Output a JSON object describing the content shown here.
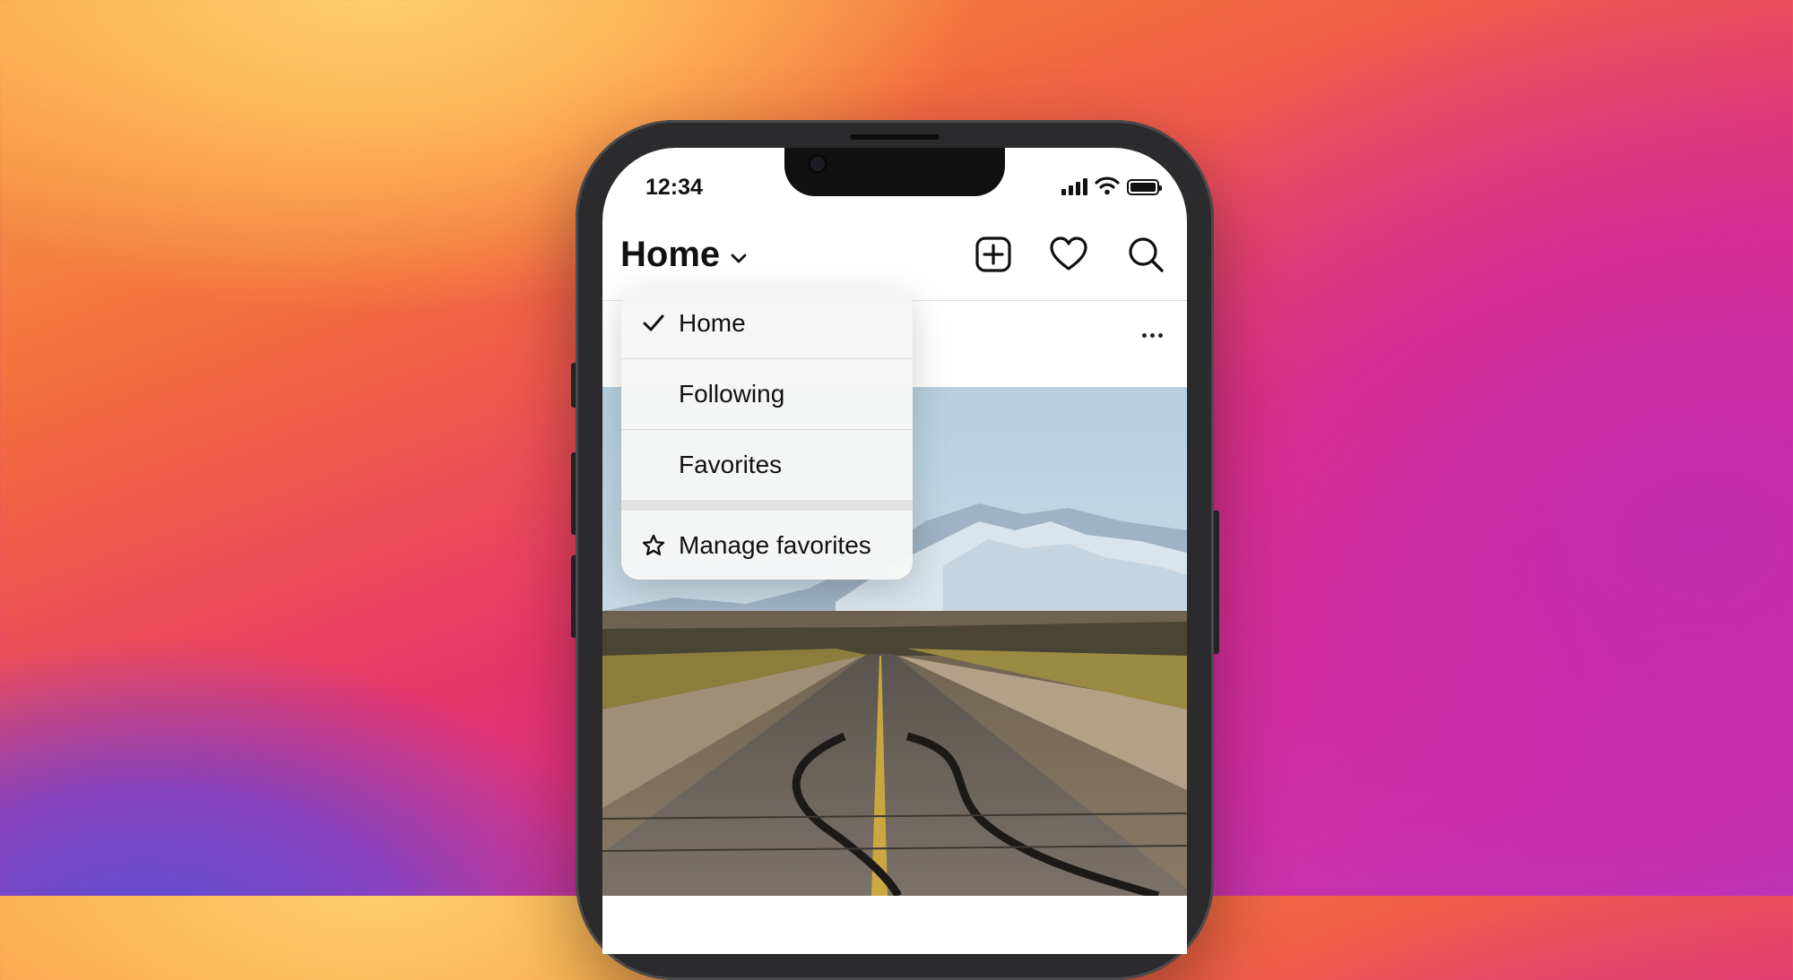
{
  "status_bar": {
    "time": "12:34",
    "icons": [
      "signal-icon",
      "wifi-icon",
      "battery-icon"
    ]
  },
  "header": {
    "title": "Home",
    "icons": [
      "add-post-icon",
      "heart-icon",
      "search-icon"
    ]
  },
  "feed_menu": {
    "items": [
      {
        "label": "Home",
        "selected": true,
        "icon": "checkmark-icon"
      },
      {
        "label": "Following",
        "selected": false
      },
      {
        "label": "Favorites",
        "selected": false
      }
    ],
    "footer_item": {
      "label": "Manage favorites",
      "icon": "star-icon"
    }
  },
  "post": {
    "more_icon": "more-dots-icon",
    "image_subject": "desert road toward mountains"
  },
  "colors": {
    "bg_orange": "#f7a548",
    "bg_pink": "#e8356a",
    "bg_purple": "#b43bc1",
    "phone_frame": "#2b2b2d"
  }
}
